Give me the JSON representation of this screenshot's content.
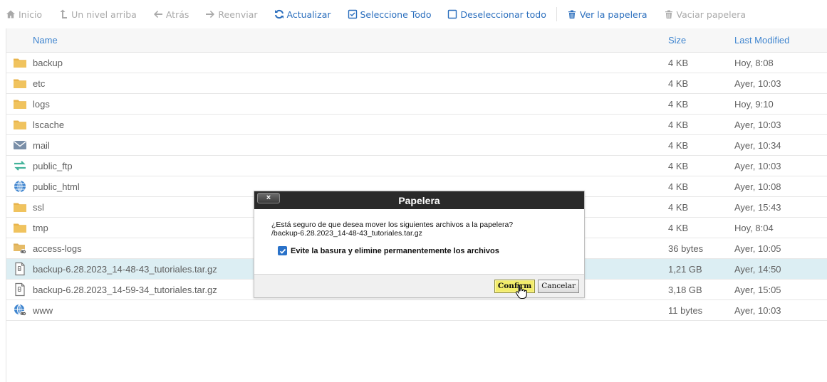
{
  "toolbar": {
    "home": "Inicio",
    "up": "Un nivel arriba",
    "back": "Atrás",
    "forward": "Reenviar",
    "reload": "Actualizar",
    "select_all": "Seleccione Todo",
    "deselect_all": "Deseleccionar todo",
    "view_trash": "Ver la papelera",
    "empty_trash": "Vaciar papelera"
  },
  "table": {
    "headers": {
      "name": "Name",
      "size": "Size",
      "modified": "Last Modified"
    },
    "rows": [
      {
        "icon": "folder-icon",
        "name": "backup",
        "size": "4 KB",
        "modified": "Hoy, 8:08"
      },
      {
        "icon": "folder-icon",
        "name": "etc",
        "size": "4 KB",
        "modified": "Ayer, 10:03"
      },
      {
        "icon": "folder-icon",
        "name": "logs",
        "size": "4 KB",
        "modified": "Hoy, 9:10"
      },
      {
        "icon": "folder-icon",
        "name": "lscache",
        "size": "4 KB",
        "modified": "Ayer, 10:03"
      },
      {
        "icon": "mail-icon",
        "name": "mail",
        "size": "4 KB",
        "modified": "Ayer, 10:34"
      },
      {
        "icon": "transfer-icon",
        "name": "public_ftp",
        "size": "4 KB",
        "modified": "Ayer, 10:03"
      },
      {
        "icon": "globe-icon",
        "name": "public_html",
        "size": "4 KB",
        "modified": "Ayer, 10:08"
      },
      {
        "icon": "folder-icon",
        "name": "ssl",
        "size": "4 KB",
        "modified": "Ayer, 15:43"
      },
      {
        "icon": "folder-icon",
        "name": "tmp",
        "size": "4 KB",
        "modified": "Hoy, 8:04"
      },
      {
        "icon": "folder-link-icon",
        "name": "access-logs",
        "size": "36 bytes",
        "modified": "Ayer, 10:05"
      },
      {
        "icon": "archive-file-icon",
        "name": "backup-6.28.2023_14-48-43_tutoriales.tar.gz",
        "size": "1,21 GB",
        "modified": "Ayer, 14:50",
        "selected": true
      },
      {
        "icon": "archive-file-icon",
        "name": "backup-6.28.2023_14-59-34_tutoriales.tar.gz",
        "size": "3,18 GB",
        "modified": "Ayer, 15:05"
      },
      {
        "icon": "globe-link-icon",
        "name": "www",
        "size": "11 bytes",
        "modified": "Ayer, 10:03"
      }
    ]
  },
  "dialog": {
    "close_label": "×",
    "title": "Papelera",
    "question": "¿Está seguro de que desea mover los siguientes archivos a la papelera?",
    "file": "/backup-6.28.2023_14-48-43_tutoriales.tar.gz",
    "checkbox_label": "Evite la basura y elimine permanentemente los archivos",
    "checkbox_checked": true,
    "confirm": "Confirm",
    "cancel": "Cancelar"
  },
  "colors": {
    "accent": "#2a6ebd",
    "header_text": "#3f85cf",
    "folder": "#e8b44c",
    "selected_row": "#dceef3",
    "dialog_title_bg": "#2a2a2a",
    "confirm_bg": "#f2ec6b"
  }
}
